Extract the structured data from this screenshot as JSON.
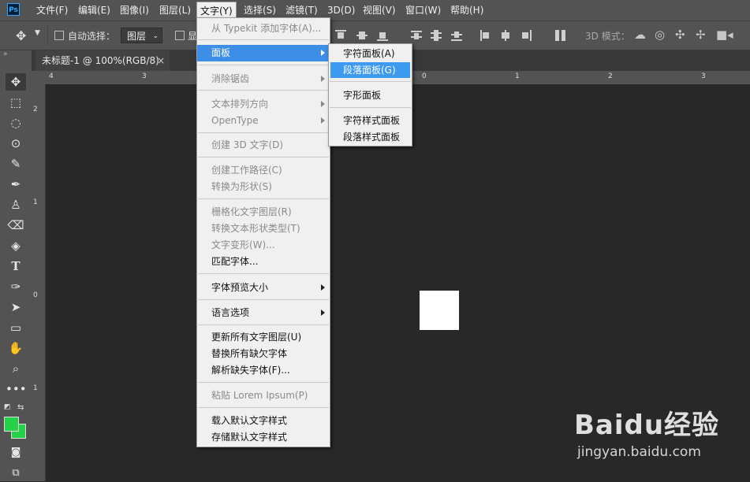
{
  "app": {
    "logo": "Ps",
    "accent": "#31a8ff"
  },
  "menubar": {
    "items": [
      "文件(F)",
      "编辑(E)",
      "图像(I)",
      "图层(L)",
      "文字(Y)",
      "选择(S)",
      "滤镜(T)",
      "3D(D)",
      "视图(V)",
      "窗口(W)",
      "帮助(H)"
    ],
    "active": "文字(Y)"
  },
  "options_bar": {
    "auto_select_label": "自动选择：",
    "auto_select_value": "图层",
    "show_transform_prefix": "显",
    "mode_3d_label": "3D 模式："
  },
  "document_tab": {
    "title": "未标题-1 @ 100%(RGB/8)",
    "close": "×"
  },
  "rulers": {
    "top": [
      "4",
      "3",
      "0",
      "1",
      "2",
      "3"
    ],
    "left": [
      "2",
      "1",
      "0",
      "1"
    ]
  },
  "type_menu": {
    "items": [
      {
        "label": "从 Typekit 添加字体(A)...",
        "disabled": true
      },
      {
        "label": "面板",
        "submenu": true,
        "highlighted": true
      },
      {
        "label": "消除锯齿",
        "disabled": true,
        "submenu": true
      },
      {
        "label": "文本排列方向",
        "disabled": true,
        "submenu": true
      },
      {
        "label": "OpenType",
        "disabled": true,
        "submenu": true
      },
      {
        "label": "创建 3D 文字(D)",
        "disabled": true
      },
      {
        "label": "创建工作路径(C)",
        "disabled": true
      },
      {
        "label": "转换为形状(S)",
        "disabled": true
      },
      {
        "label": "栅格化文字图层(R)",
        "disabled": true
      },
      {
        "label": "转换文本形状类型(T)",
        "disabled": true
      },
      {
        "label": "文字变形(W)...",
        "disabled": true
      },
      {
        "label": "匹配字体..."
      },
      {
        "label": "字体预览大小",
        "submenu": true
      },
      {
        "label": "语言选项",
        "submenu": true
      },
      {
        "label": "更新所有文字图层(U)"
      },
      {
        "label": "替换所有缺欠字体"
      },
      {
        "label": "解析缺失字体(F)..."
      },
      {
        "label": "粘贴 Lorem Ipsum(P)",
        "disabled": true
      },
      {
        "label": "载入默认文字样式"
      },
      {
        "label": "存储默认文字样式"
      }
    ]
  },
  "panel_submenu": {
    "items": [
      "字符面板(A)",
      "段落面板(G)",
      "字形面板",
      "字符样式面板",
      "段落样式面板"
    ],
    "highlighted": "段落面板(G)"
  },
  "colors": {
    "foreground": "#26d14a",
    "background": "#26d14a"
  },
  "watermark": {
    "brand": "Baidu经验",
    "url": "jingyan.baidu.com"
  }
}
